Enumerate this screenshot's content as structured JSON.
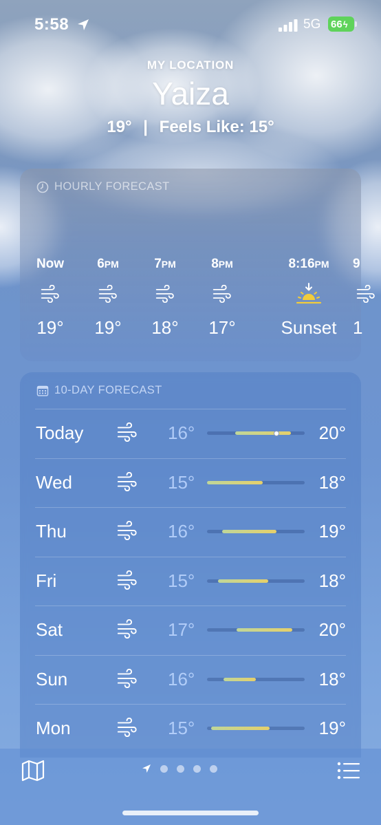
{
  "status_bar": {
    "time": "5:58",
    "network": "5G",
    "battery": "66"
  },
  "header": {
    "location_label": "MY LOCATION",
    "city": "Yaiza",
    "current_temp": "19°",
    "separator": "|",
    "feels_like": "Feels Like: 15°"
  },
  "hourly": {
    "title": "HOURLY FORECAST",
    "items": [
      {
        "time": "Now",
        "ampm": "",
        "icon": "wind-icon",
        "value": "19°"
      },
      {
        "time": "6",
        "ampm": "PM",
        "icon": "wind-icon",
        "value": "19°"
      },
      {
        "time": "7",
        "ampm": "PM",
        "icon": "wind-icon",
        "value": "18°"
      },
      {
        "time": "8",
        "ampm": "PM",
        "icon": "wind-icon",
        "value": "17°"
      },
      {
        "time": "8:16",
        "ampm": "PM",
        "icon": "sunset-icon",
        "value": "Sunset"
      },
      {
        "time": "9",
        "ampm": "",
        "icon": "wind-icon",
        "value": "1"
      }
    ]
  },
  "daily": {
    "title": "10-DAY FORECAST",
    "range_min": 14,
    "range_max": 21,
    "current_temp_value": 19,
    "rows": [
      {
        "day": "Today",
        "icon": "wind-icon",
        "low": "16°",
        "high": "20°",
        "low_value": 16,
        "high_value": 20,
        "show_current": true
      },
      {
        "day": "Wed",
        "icon": "wind-icon",
        "low": "15°",
        "high": "18°",
        "low_value": 14,
        "high_value": 18,
        "show_current": false
      },
      {
        "day": "Thu",
        "icon": "wind-icon",
        "low": "16°",
        "high": "19°",
        "low_value": 15.1,
        "high_value": 19,
        "show_current": false
      },
      {
        "day": "Fri",
        "icon": "wind-icon",
        "low": "15°",
        "high": "18°",
        "low_value": 14.8,
        "high_value": 18.4,
        "show_current": false
      },
      {
        "day": "Sat",
        "icon": "wind-icon",
        "low": "17°",
        "high": "20°",
        "low_value": 16.1,
        "high_value": 20.1,
        "show_current": false
      },
      {
        "day": "Sun",
        "icon": "wind-icon",
        "low": "16°",
        "high": "18°",
        "low_value": 15.2,
        "high_value": 17.5,
        "show_current": false
      },
      {
        "day": "Mon",
        "icon": "wind-icon",
        "low": "15°",
        "high": "19°",
        "low_value": 14.3,
        "high_value": 18.5,
        "show_current": false
      }
    ]
  },
  "bottom": {
    "map_icon": "map-icon",
    "list_icon": "list-icon",
    "page_count": 5,
    "current_page": 0
  }
}
